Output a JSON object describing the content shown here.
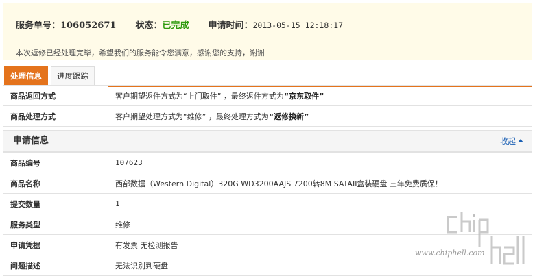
{
  "summary": {
    "order_label": "服务单号：",
    "order_number": "106052671",
    "status_label": "状态：",
    "status_value": "已完成",
    "time_label": "申请时间：",
    "time_value": "2013-05-15 12:18:17",
    "message": "本次返修已经处理完毕，希望我们的服务能令您满意，感谢您的支持，谢谢"
  },
  "tabs": [
    {
      "label": "处理信息",
      "active": true
    },
    {
      "label": "进度跟踪",
      "active": false
    }
  ],
  "process": {
    "rows": [
      {
        "label": "商品返回方式",
        "prefix": "客户期望返件方式为“上门取件” ，最终返件方式为",
        "emphasis": "“京东取件”"
      },
      {
        "label": "商品处理方式",
        "prefix": "客户期望处理方式为“维修” ，最终处理方式为",
        "emphasis": "“返修换新”"
      }
    ]
  },
  "application": {
    "title": "申请信息",
    "collapse_label": "收起",
    "rows": [
      {
        "label": "商品编号",
        "value": "107623"
      },
      {
        "label": "商品名称",
        "value": "西部数据（Western Digital）320G WD3200AAJS 7200转8M SATAII盒装硬盘 三年免费质保！"
      },
      {
        "label": "提交数量",
        "value": "1"
      },
      {
        "label": "服务类型",
        "value": "维修"
      },
      {
        "label": "申请凭据",
        "value": "有发票 无检测报告"
      },
      {
        "label": "问题描述",
        "value": "无法识别到硬盘"
      }
    ]
  },
  "watermark": {
    "logo": "chip hell",
    "url": "www.chiphell.com"
  },
  "colors": {
    "accent": "#e4731c",
    "status_green": "#2f9a0e",
    "link_blue": "#1a5fb4",
    "summary_bg": "#fffbe8"
  }
}
